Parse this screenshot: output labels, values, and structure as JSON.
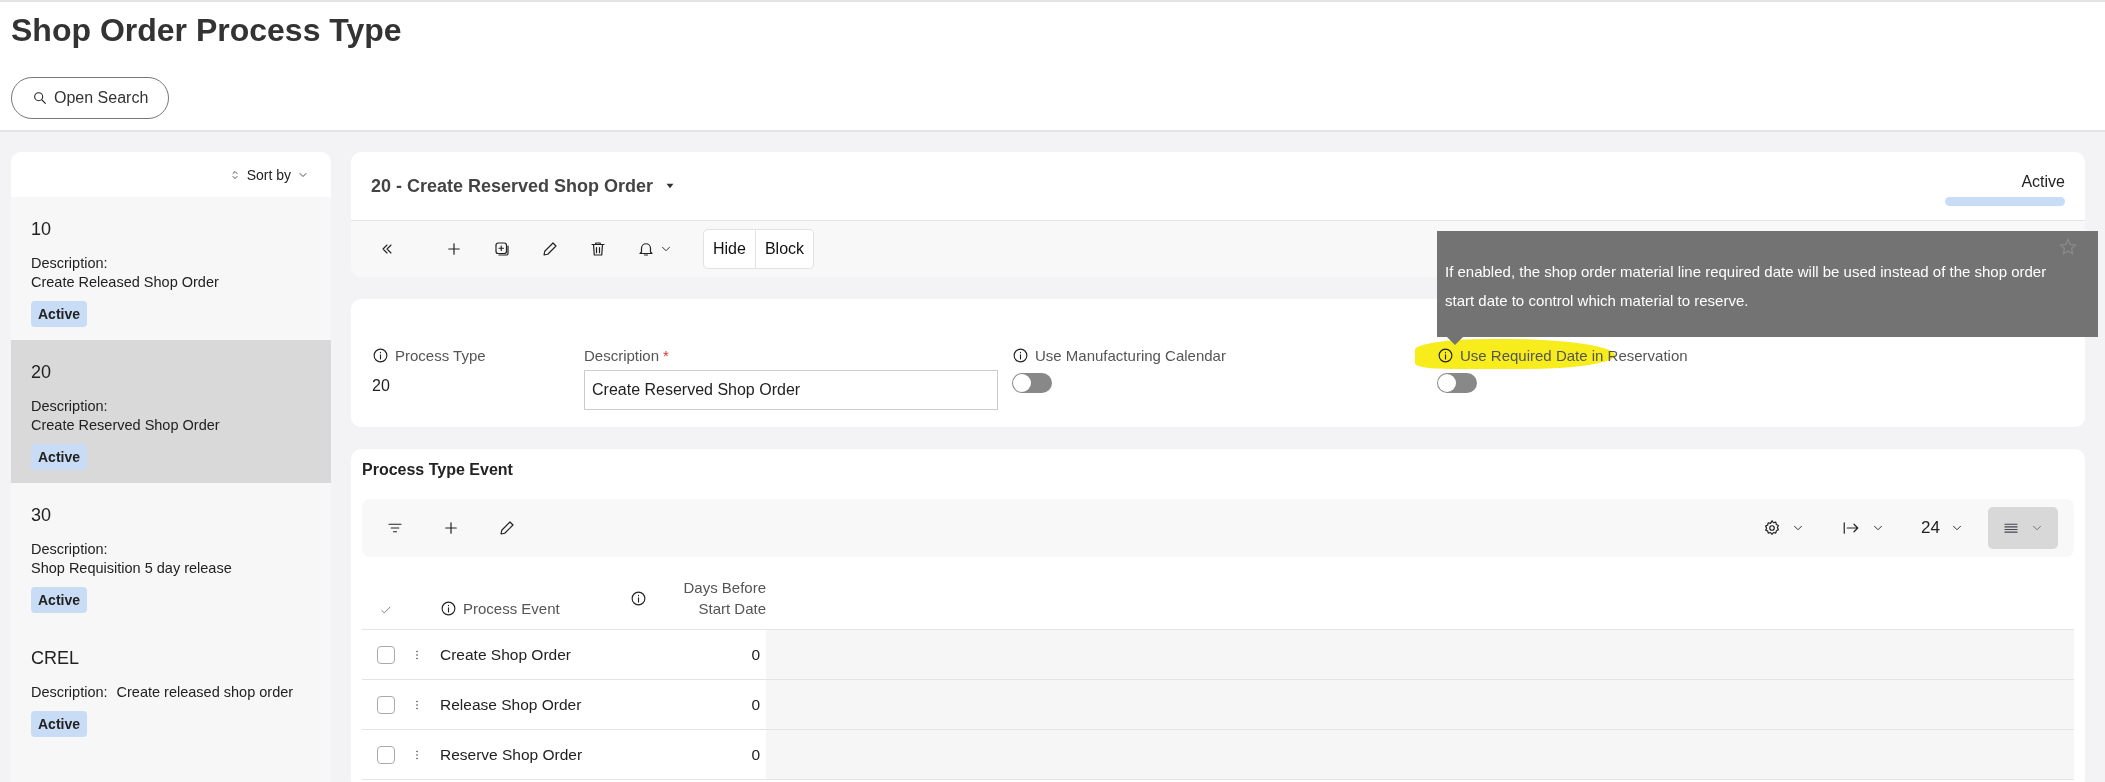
{
  "page": {
    "title": "Shop Order Process Type",
    "search_button": "Open Search"
  },
  "list": {
    "sort_label": "Sort by",
    "items": [
      {
        "id": "10",
        "description_label": "Description:",
        "description": "Create Released Shop Order",
        "status": "Active",
        "kind": "stacked",
        "selected": false
      },
      {
        "id": "20",
        "description_label": "Description:",
        "description": "Create Reserved Shop Order",
        "status": "Active",
        "kind": "stacked",
        "selected": true
      },
      {
        "id": "30",
        "description_label": "Description:",
        "description": "Shop Requisition 5 day release",
        "status": "Active",
        "kind": "stacked",
        "selected": false
      },
      {
        "id": "CREL",
        "description_label": "Description:",
        "description": "Create released shop order",
        "status": "Active",
        "kind": "inline",
        "selected": false
      }
    ]
  },
  "record": {
    "title": "20 - Create Reserved Shop Order",
    "status": "Active",
    "buttons": [
      "Hide",
      "Block"
    ]
  },
  "form": {
    "fields": [
      {
        "kind": "text",
        "label": "Process Type",
        "value": "20"
      },
      {
        "kind": "input",
        "label": "Description",
        "required_mark": "*",
        "value": "Create Reserved Shop Order"
      },
      {
        "kind": "toggle",
        "label": "Use Manufacturing Calendar",
        "on": false,
        "highlighted": false
      },
      {
        "kind": "toggle",
        "label": "Use Required Date in Reservation",
        "on": false,
        "highlighted": true
      }
    ]
  },
  "tooltip": {
    "text": "If enabled, the shop order material line required date will be used instead of the shop order start date to control which material to reserve."
  },
  "events": {
    "title": "Process Type Event",
    "page_size": "24",
    "columns": [
      "Process Event",
      "Days Before Start Date"
    ],
    "rows": [
      {
        "event": "Create Shop Order",
        "days": "0",
        "checked": false
      },
      {
        "event": "Release Shop Order",
        "days": "0",
        "checked": false
      },
      {
        "event": "Reserve Shop Order",
        "days": "0",
        "checked": false
      }
    ]
  }
}
